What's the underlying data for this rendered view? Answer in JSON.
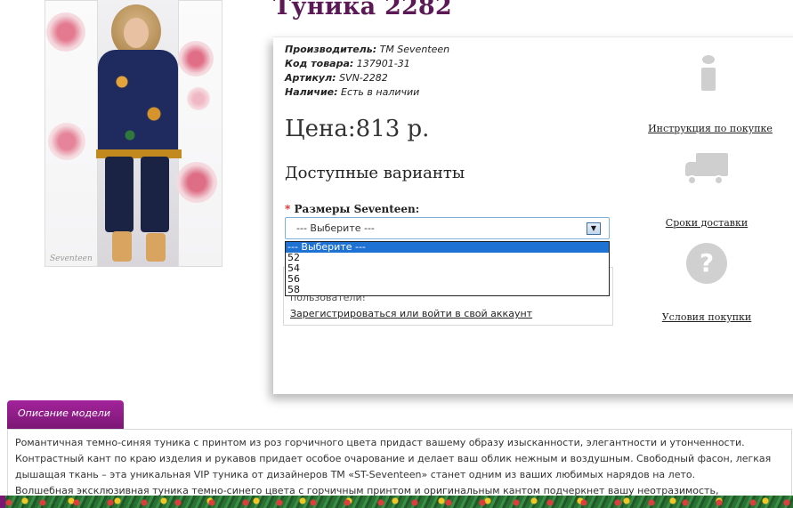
{
  "product": {
    "title": "Туника 2282",
    "photo_signature": "Seventeen"
  },
  "details": {
    "manufacturer_label": "Производитель:",
    "manufacturer_value": "TM Seventeen",
    "code_label": "Код товара:",
    "code_value": "137901-31",
    "article_label": "Артикул:",
    "article_value": "SVN-2282",
    "stock_label": "Наличие:",
    "stock_value": "Есть в наличии"
  },
  "price": {
    "text": "Цена:813 р."
  },
  "variants": {
    "title": "Доступные варианты",
    "size_label_required": "*",
    "size_label": "Размеры Seventeen:",
    "select_value": "--- Выберите ---",
    "options": [
      {
        "label": "--- Выберите ---",
        "selected": true
      },
      {
        "label": "52",
        "selected": false
      },
      {
        "label": "54",
        "selected": false
      },
      {
        "label": "56",
        "selected": false
      },
      {
        "label": "58",
        "selected": false
      }
    ]
  },
  "login": {
    "note": "пользователи!",
    "link": "Зарегистрироваться или войти в свой аккаунт"
  },
  "side_links": {
    "instruction": "Инструкция по покупке",
    "delivery": "Сроки доставки",
    "conditions": "Условия покупки"
  },
  "icons": {
    "info": "info-icon",
    "delivery": "truck-icon",
    "conditions": "question-icon"
  },
  "description": {
    "tab_label": "Описание модели",
    "paragraph1": "Романтичная темно-синяя туника с принтом из роз горчичного цвета придаст вашему образу изысканности, элегантности и утонченности. Контрастный кант по краю изделия и рукавов придает особое очарование и делает ваш облик нежным и воздушным. Свободный фасон, легкая дышащая ткань – эта уникальная VIP туника от дизайнеров ТМ «ST-Seventeen» станет одним из ваших любимых нарядов на лето.",
    "paragraph2": "Волшебная эксклюзивная туника темно-синего цвета с горчичным принтом и оригинальным кантом подчеркнет вашу неотразимость, элегантность и чувство"
  },
  "colors": {
    "title": "#5b1a55",
    "tab_bg": "#a3239b",
    "select_highlight": "#1e72d4",
    "select_border": "#7fb2d8"
  }
}
